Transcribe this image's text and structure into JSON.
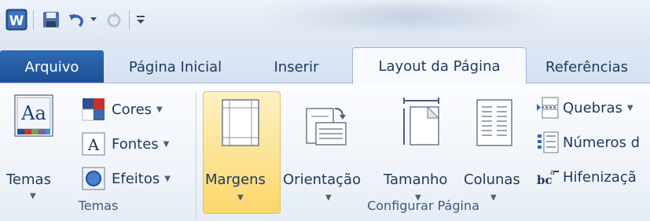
{
  "quick_access": {
    "icons": [
      "word-app-icon",
      "save-icon",
      "undo-icon",
      "redo-icon",
      "customize-qat-icon"
    ],
    "app_letter": "W"
  },
  "tabs": [
    {
      "label": "Arquivo",
      "active": false,
      "file": true
    },
    {
      "label": "Página Inicial",
      "active": false
    },
    {
      "label": "Inserir",
      "active": false
    },
    {
      "label": "Layout da Página",
      "active": true
    },
    {
      "label": "Referências",
      "active": false
    }
  ],
  "groups": {
    "temas": {
      "label": "Temas",
      "big_button": {
        "label": "Temas",
        "icon": "themes-icon",
        "icon_text": "Aa"
      },
      "small_buttons": [
        {
          "label": "Cores",
          "icon": "colors-icon"
        },
        {
          "label": "Fontes",
          "icon": "fonts-icon",
          "icon_text": "A"
        },
        {
          "label": "Efeitos",
          "icon": "effects-icon"
        }
      ]
    },
    "configurar_pagina": {
      "label": "Configurar Página",
      "big_buttons": [
        {
          "label": "Margens",
          "icon": "margins-icon",
          "highlighted": true
        },
        {
          "label": "Orientação",
          "icon": "orientation-icon"
        },
        {
          "label": "Tamanho",
          "icon": "size-icon"
        },
        {
          "label": "Colunas",
          "icon": "columns-icon"
        }
      ],
      "small_buttons": [
        {
          "label": "Quebras",
          "icon": "breaks-icon"
        },
        {
          "label": "Números d",
          "icon": "line-numbers-icon"
        },
        {
          "label": "Hifenizaçã",
          "icon": "hyphenation-icon",
          "icon_text": "bc"
        }
      ]
    }
  },
  "colors": {
    "accent": "#2a62ad",
    "highlight": "#fce59a",
    "text": "#1e395b"
  }
}
